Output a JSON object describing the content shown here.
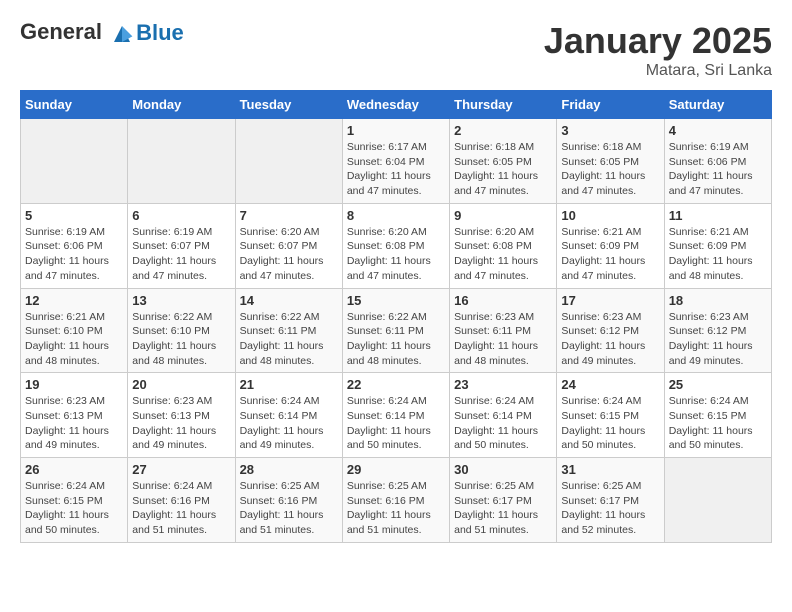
{
  "header": {
    "logo_line1": "General",
    "logo_line2": "Blue",
    "month": "January 2025",
    "location": "Matara, Sri Lanka"
  },
  "days_of_week": [
    "Sunday",
    "Monday",
    "Tuesday",
    "Wednesday",
    "Thursday",
    "Friday",
    "Saturday"
  ],
  "weeks": [
    [
      {
        "day": "",
        "info": ""
      },
      {
        "day": "",
        "info": ""
      },
      {
        "day": "",
        "info": ""
      },
      {
        "day": "1",
        "info": "Sunrise: 6:17 AM\nSunset: 6:04 PM\nDaylight: 11 hours and 47 minutes."
      },
      {
        "day": "2",
        "info": "Sunrise: 6:18 AM\nSunset: 6:05 PM\nDaylight: 11 hours and 47 minutes."
      },
      {
        "day": "3",
        "info": "Sunrise: 6:18 AM\nSunset: 6:05 PM\nDaylight: 11 hours and 47 minutes."
      },
      {
        "day": "4",
        "info": "Sunrise: 6:19 AM\nSunset: 6:06 PM\nDaylight: 11 hours and 47 minutes."
      }
    ],
    [
      {
        "day": "5",
        "info": "Sunrise: 6:19 AM\nSunset: 6:06 PM\nDaylight: 11 hours and 47 minutes."
      },
      {
        "day": "6",
        "info": "Sunrise: 6:19 AM\nSunset: 6:07 PM\nDaylight: 11 hours and 47 minutes."
      },
      {
        "day": "7",
        "info": "Sunrise: 6:20 AM\nSunset: 6:07 PM\nDaylight: 11 hours and 47 minutes."
      },
      {
        "day": "8",
        "info": "Sunrise: 6:20 AM\nSunset: 6:08 PM\nDaylight: 11 hours and 47 minutes."
      },
      {
        "day": "9",
        "info": "Sunrise: 6:20 AM\nSunset: 6:08 PM\nDaylight: 11 hours and 47 minutes."
      },
      {
        "day": "10",
        "info": "Sunrise: 6:21 AM\nSunset: 6:09 PM\nDaylight: 11 hours and 47 minutes."
      },
      {
        "day": "11",
        "info": "Sunrise: 6:21 AM\nSunset: 6:09 PM\nDaylight: 11 hours and 48 minutes."
      }
    ],
    [
      {
        "day": "12",
        "info": "Sunrise: 6:21 AM\nSunset: 6:10 PM\nDaylight: 11 hours and 48 minutes."
      },
      {
        "day": "13",
        "info": "Sunrise: 6:22 AM\nSunset: 6:10 PM\nDaylight: 11 hours and 48 minutes."
      },
      {
        "day": "14",
        "info": "Sunrise: 6:22 AM\nSunset: 6:11 PM\nDaylight: 11 hours and 48 minutes."
      },
      {
        "day": "15",
        "info": "Sunrise: 6:22 AM\nSunset: 6:11 PM\nDaylight: 11 hours and 48 minutes."
      },
      {
        "day": "16",
        "info": "Sunrise: 6:23 AM\nSunset: 6:11 PM\nDaylight: 11 hours and 48 minutes."
      },
      {
        "day": "17",
        "info": "Sunrise: 6:23 AM\nSunset: 6:12 PM\nDaylight: 11 hours and 49 minutes."
      },
      {
        "day": "18",
        "info": "Sunrise: 6:23 AM\nSunset: 6:12 PM\nDaylight: 11 hours and 49 minutes."
      }
    ],
    [
      {
        "day": "19",
        "info": "Sunrise: 6:23 AM\nSunset: 6:13 PM\nDaylight: 11 hours and 49 minutes."
      },
      {
        "day": "20",
        "info": "Sunrise: 6:23 AM\nSunset: 6:13 PM\nDaylight: 11 hours and 49 minutes."
      },
      {
        "day": "21",
        "info": "Sunrise: 6:24 AM\nSunset: 6:14 PM\nDaylight: 11 hours and 49 minutes."
      },
      {
        "day": "22",
        "info": "Sunrise: 6:24 AM\nSunset: 6:14 PM\nDaylight: 11 hours and 50 minutes."
      },
      {
        "day": "23",
        "info": "Sunrise: 6:24 AM\nSunset: 6:14 PM\nDaylight: 11 hours and 50 minutes."
      },
      {
        "day": "24",
        "info": "Sunrise: 6:24 AM\nSunset: 6:15 PM\nDaylight: 11 hours and 50 minutes."
      },
      {
        "day": "25",
        "info": "Sunrise: 6:24 AM\nSunset: 6:15 PM\nDaylight: 11 hours and 50 minutes."
      }
    ],
    [
      {
        "day": "26",
        "info": "Sunrise: 6:24 AM\nSunset: 6:15 PM\nDaylight: 11 hours and 50 minutes."
      },
      {
        "day": "27",
        "info": "Sunrise: 6:24 AM\nSunset: 6:16 PM\nDaylight: 11 hours and 51 minutes."
      },
      {
        "day": "28",
        "info": "Sunrise: 6:25 AM\nSunset: 6:16 PM\nDaylight: 11 hours and 51 minutes."
      },
      {
        "day": "29",
        "info": "Sunrise: 6:25 AM\nSunset: 6:16 PM\nDaylight: 11 hours and 51 minutes."
      },
      {
        "day": "30",
        "info": "Sunrise: 6:25 AM\nSunset: 6:17 PM\nDaylight: 11 hours and 51 minutes."
      },
      {
        "day": "31",
        "info": "Sunrise: 6:25 AM\nSunset: 6:17 PM\nDaylight: 11 hours and 52 minutes."
      },
      {
        "day": "",
        "info": ""
      }
    ]
  ]
}
